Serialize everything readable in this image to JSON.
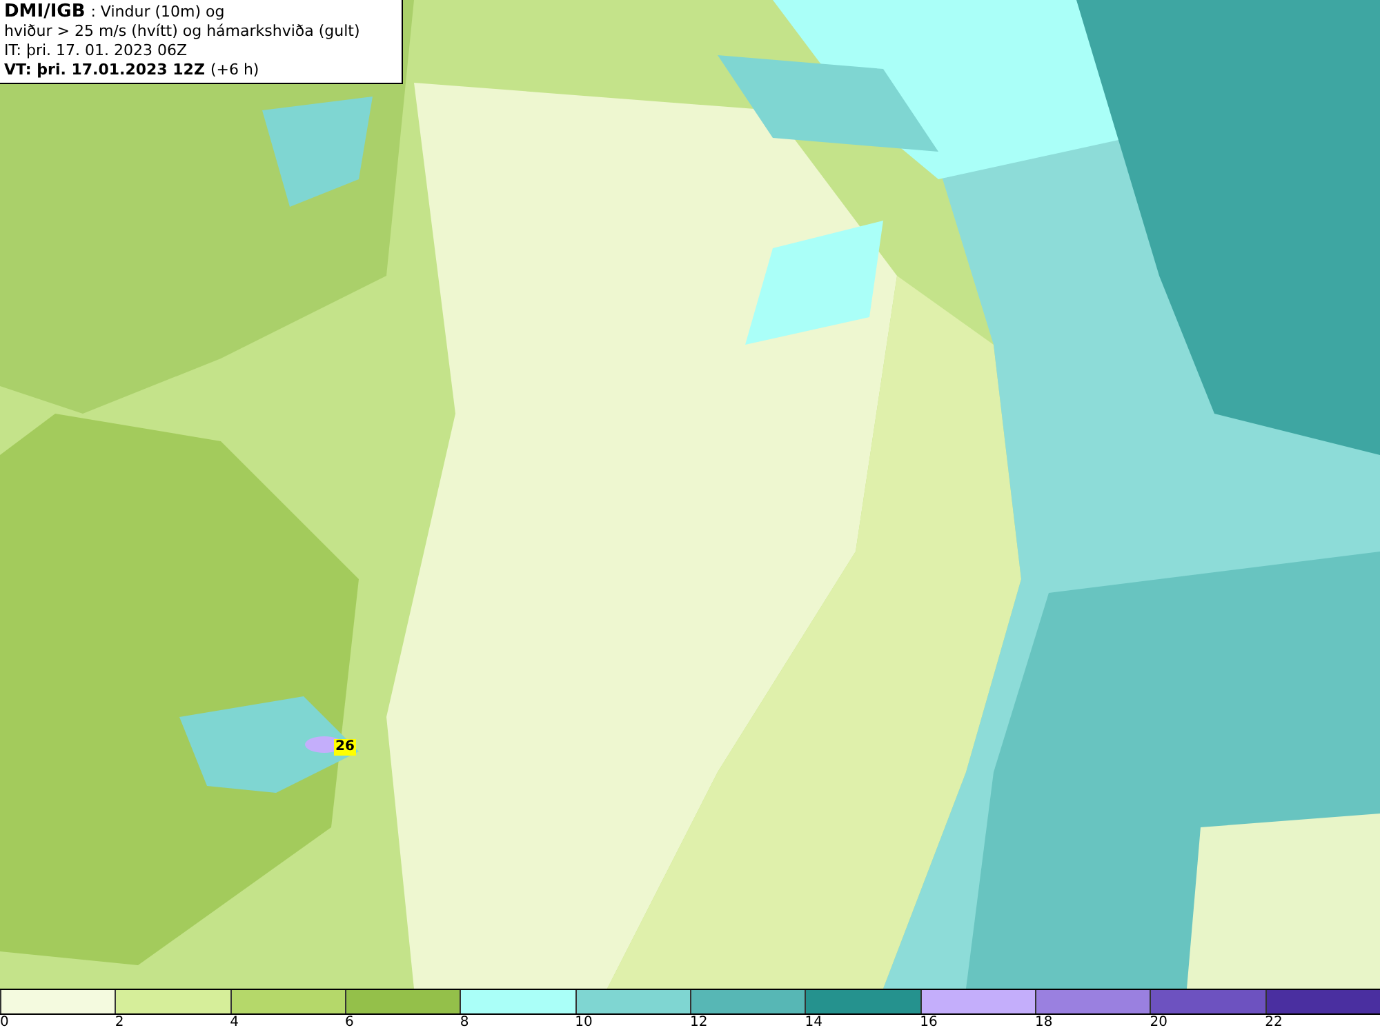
{
  "header": {
    "source": "DMI/IGB",
    "title": ": Vindur (10m) og",
    "subtitle": "hviður > 25 m/s (hvítt) og hámarkshviða (gult)",
    "issue_time": "IT: þri. 17. 01. 2023 06Z",
    "valid_time": "VT: þri. 17.01.2023 12Z",
    "lead": "(+6 h)"
  },
  "map": {
    "gust_label": "26"
  },
  "legend": {
    "bins": [
      {
        "color": "#f4fadf"
      },
      {
        "color": "#d6ee9a"
      },
      {
        "color": "#b5d86a"
      },
      {
        "color": "#94c04a"
      },
      {
        "color": "#aafff8"
      },
      {
        "color": "#7fd6d2"
      },
      {
        "color": "#57b7b5"
      },
      {
        "color": "#25928e"
      },
      {
        "color": "#c4aefb"
      },
      {
        "color": "#9a80e0"
      },
      {
        "color": "#6d52c0"
      },
      {
        "color": "#4a2fa0"
      }
    ],
    "ticks": [
      "0",
      "2",
      "4",
      "6",
      "8",
      "10",
      "12",
      "14",
      "16",
      "18",
      "20",
      "22"
    ]
  }
}
